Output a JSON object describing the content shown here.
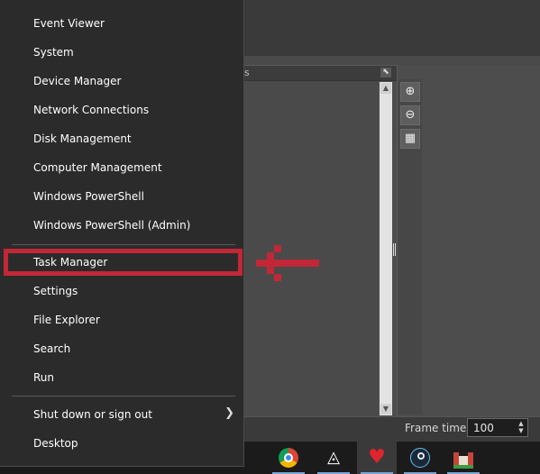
{
  "winx_menu": {
    "items": [
      {
        "label": "Event Viewer"
      },
      {
        "label": "System"
      },
      {
        "label": "Device Manager"
      },
      {
        "label": "Network Connections"
      },
      {
        "label": "Disk Management"
      },
      {
        "label": "Computer Management"
      },
      {
        "label": "Windows PowerShell"
      },
      {
        "label": "Windows PowerShell (Admin)"
      },
      {
        "label": "Task Manager"
      },
      {
        "label": "Settings"
      },
      {
        "label": "File Explorer"
      },
      {
        "label": "Search"
      },
      {
        "label": "Run"
      },
      {
        "label": "Shut down or sign out"
      },
      {
        "label": "Desktop"
      }
    ],
    "highlighted_item": "Task Manager",
    "highlight_color": "#c22737"
  },
  "app": {
    "panel_header": "s",
    "frame_time_label": "Frame time",
    "frame_time_value": "100",
    "tools": [
      "zoom-in-icon",
      "zoom-out-icon",
      "fit-icon"
    ]
  },
  "taskbar": {
    "apps": [
      "chrome-icon",
      "unity-icon",
      "heart-icon",
      "steam-icon",
      "castle-icon"
    ]
  }
}
